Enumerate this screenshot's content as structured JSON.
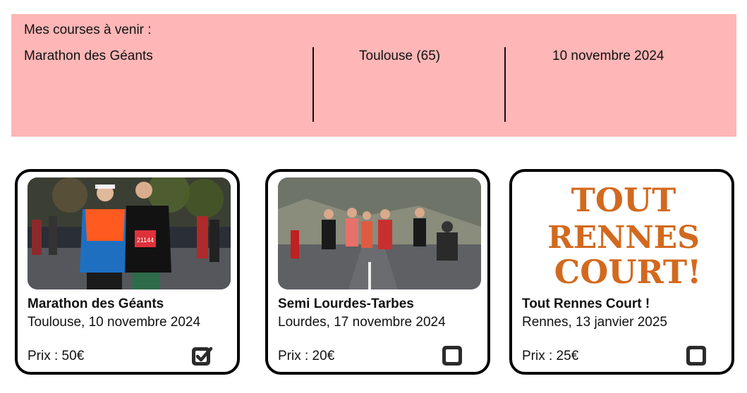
{
  "upcoming": {
    "title": "Mes courses à venir :",
    "race": {
      "name": "Marathon des Géants",
      "location": "Toulouse (65)",
      "date": "10 novembre 2024"
    }
  },
  "cards": [
    {
      "title": "Marathon des Géants",
      "subtitle": "Toulouse, 10 novembre 2024",
      "price": "Prix : 50€",
      "checked": true,
      "bib": "21144"
    },
    {
      "title": "Semi Lourdes-Tarbes",
      "subtitle": "Lourdes, 17 novembre 2024",
      "price": "Prix : 20€",
      "checked": false
    },
    {
      "title": "Tout Rennes Court !",
      "subtitle": "Rennes, 13 janvier 2025",
      "price": "Prix : 25€",
      "checked": false,
      "logo_lines": [
        "TOUT",
        "RENNES",
        "COURT!"
      ],
      "logo_color": "#d2691e"
    }
  ],
  "colors": {
    "banner_bg": "#ffb6b6",
    "border": "#000000"
  }
}
